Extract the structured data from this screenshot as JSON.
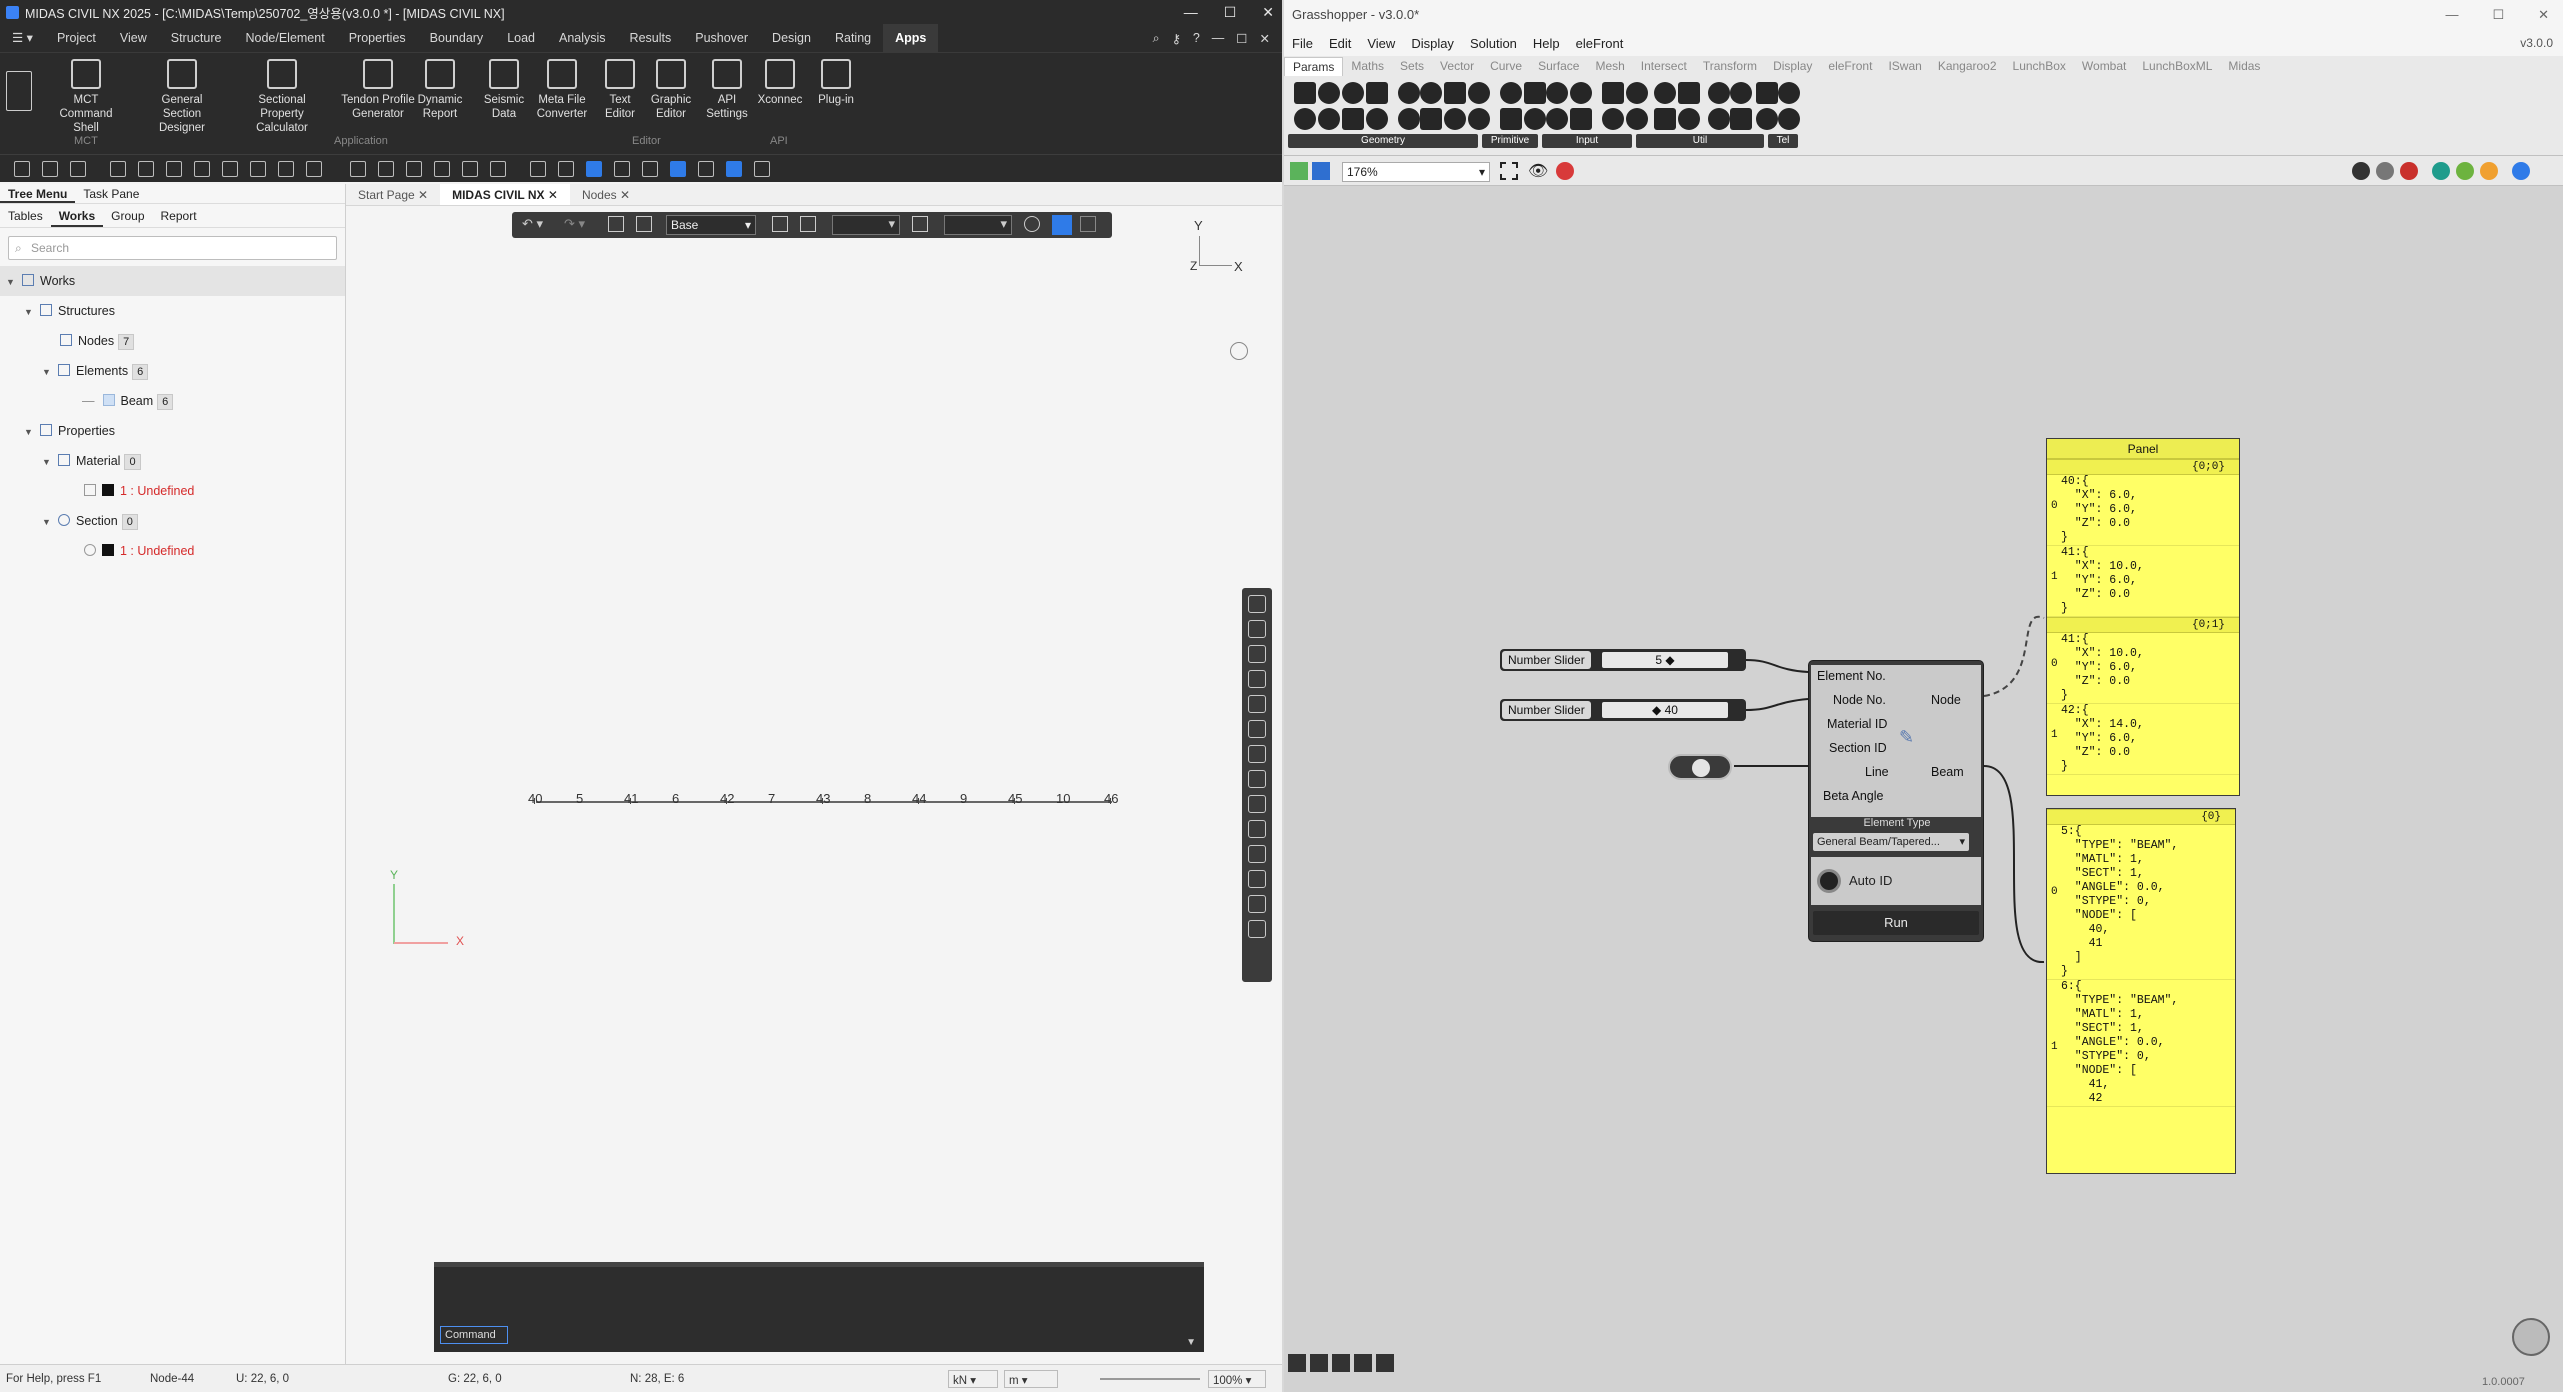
{
  "midas": {
    "window_title": "MIDAS CIVIL NX 2025 - [C:\\MIDAS\\Temp\\250702_영상용(v3.0.0 *] - [MIDAS CIVIL NX]",
    "menu": [
      "Project",
      "View",
      "Structure",
      "Node/Element",
      "Properties",
      "Boundary",
      "Load",
      "Analysis",
      "Results",
      "Pushover",
      "Design",
      "Rating",
      "Apps"
    ],
    "active_menu": "Apps",
    "ribbon": [
      {
        "label": "MCT Command Shell",
        "icon": "terminal-icon"
      },
      {
        "label": "General Section Designer",
        "icon": "section-icon"
      },
      {
        "label": "Sectional Property Calculator",
        "icon": "calculator-icon"
      },
      {
        "label": "Tendon Profile Generator",
        "icon": "tendon-icon"
      },
      {
        "label": "Dynamic Report",
        "icon": "report-icon"
      },
      {
        "label": "Seismic Data",
        "icon": "seismic-icon"
      },
      {
        "label": "Meta File Converter",
        "icon": "dxf-icon"
      },
      {
        "label": "Text Editor",
        "icon": "text-editor-icon"
      },
      {
        "label": "Graphic Editor",
        "icon": "graphic-editor-icon"
      },
      {
        "label": "API Settings",
        "icon": "cloud-icon"
      },
      {
        "label": "Xconnec",
        "icon": "connect-icon"
      },
      {
        "label": "Plug-in",
        "icon": "plugin-icon"
      }
    ],
    "ribbon_groups": [
      "MCT",
      "Application",
      "Editor",
      "API"
    ],
    "tree": {
      "panel_tabs": [
        "Tree Menu",
        "Task Pane"
      ],
      "sub_tabs": [
        "Tables",
        "Works",
        "Group",
        "Report"
      ],
      "search_placeholder": "Search",
      "works": "Works",
      "structures": "Structures",
      "nodes": "Nodes",
      "nodes_count": "7",
      "elements": "Elements",
      "elements_count": "6",
      "beam": "Beam",
      "beam_count": "6",
      "properties": "Properties",
      "material": "Material",
      "material_count": "0",
      "material_item": "1 : Undefined",
      "section": "Section",
      "section_count": "0",
      "section_item": "1 : Undefined"
    },
    "doc_tabs": [
      "Start Page",
      "MIDAS CIVIL NX",
      "Nodes"
    ],
    "view_select": "Base",
    "canvas_labels": [
      "40",
      "5",
      "41",
      "6",
      "42",
      "7",
      "43",
      "8",
      "44",
      "9",
      "45",
      "10",
      "46"
    ],
    "axis_labels": {
      "y": "Y",
      "x": "X",
      "z": "Z"
    },
    "command_label": "Command",
    "status": {
      "help": "For Help, press F1",
      "node": "Node-44",
      "u": "U: 22, 6, 0",
      "g": "G: 22, 6, 0",
      "ne": "N: 28, E: 6",
      "force_unit": "kN",
      "length_unit": "m",
      "zoom": "100%"
    }
  },
  "grasshopper": {
    "window_title": "Grasshopper - v3.0.0*",
    "menu": [
      "File",
      "Edit",
      "View",
      "Display",
      "Solution",
      "Help",
      "eleFront"
    ],
    "version": "v3.0.0",
    "tabs": [
      "Params",
      "Maths",
      "Sets",
      "Vector",
      "Curve",
      "Surface",
      "Mesh",
      "Intersect",
      "Transform",
      "Display",
      "eleFront",
      "ISwan",
      "Kangaroo2",
      "LunchBox",
      "Wombat",
      "LunchBoxML",
      "Midas"
    ],
    "active_tab": "Params",
    "ribbon_groups": [
      "Geometry",
      "Primitive",
      "Input",
      "Util",
      "Tel"
    ],
    "zoom": "176%",
    "slider1": {
      "label": "Number Slider",
      "value": "5"
    },
    "slider2": {
      "label": "Number Slider",
      "value": "40"
    },
    "component": {
      "inputs": [
        "Element No.",
        "Node No.",
        "Material ID",
        "Section ID",
        "Line",
        "Beta Angle"
      ],
      "outputs": [
        "Node",
        "Beam"
      ],
      "element_type_label": "Element Type",
      "element_type_value": "General Beam/Tapered...",
      "auto_id": "Auto ID",
      "run": "Run"
    },
    "panel_title": "Panel",
    "panel1": {
      "branches": [
        {
          "path": "{0;0}",
          "items": [
            {
              "idx": "0",
              "text": "40:{\n  \"X\": 6.0,\n  \"Y\": 6.0,\n  \"Z\": 0.0\n}"
            },
            {
              "idx": "1",
              "text": "41:{\n  \"X\": 10.0,\n  \"Y\": 6.0,\n  \"Z\": 0.0\n}"
            }
          ]
        },
        {
          "path": "{0;1}",
          "items": [
            {
              "idx": "0",
              "text": "41:{\n  \"X\": 10.0,\n  \"Y\": 6.0,\n  \"Z\": 0.0\n}"
            },
            {
              "idx": "1",
              "text": "42:{\n  \"X\": 14.0,\n  \"Y\": 6.0,\n  \"Z\": 0.0\n}"
            }
          ]
        }
      ]
    },
    "panel2": {
      "path": "{0}",
      "items": [
        {
          "idx": "0",
          "text": "5:{\n  \"TYPE\": \"BEAM\",\n  \"MATL\": 1,\n  \"SECT\": 1,\n  \"ANGLE\": 0.0,\n  \"STYPE\": 0,\n  \"NODE\": [\n    40,\n    41\n  ]\n}"
        },
        {
          "idx": "1",
          "text": "6:{\n  \"TYPE\": \"BEAM\",\n  \"MATL\": 1,\n  \"SECT\": 1,\n  \"ANGLE\": 0.0,\n  \"STYPE\": 0,\n  \"NODE\": [\n    41,\n    42"
        }
      ]
    },
    "footer_version": "1.0.0007"
  }
}
